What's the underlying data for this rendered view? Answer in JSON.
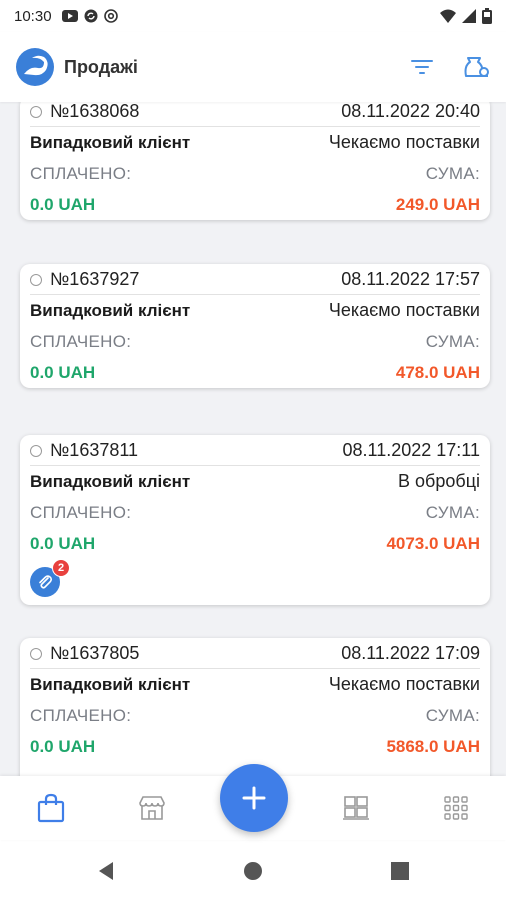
{
  "status_bar": {
    "time": "10:30"
  },
  "app_bar": {
    "title": "Продажі"
  },
  "orders": [
    {
      "number": "№1638068",
      "datetime": "08.11.2022 20:40",
      "client": "Випадковий клієнт",
      "status": "Чекаємо поставки",
      "paid_label": "СПЛАЧЕНО:",
      "sum_label": "СУМА:",
      "paid": "0.0 UAH",
      "sum": "249.0 UAH"
    },
    {
      "number": "№1637927",
      "datetime": "08.11.2022 17:57",
      "client": "Випадковий клієнт",
      "status": "Чекаємо поставки",
      "paid_label": "СПЛАЧЕНО:",
      "sum_label": "СУМА:",
      "paid": "0.0 UAH",
      "sum": "478.0 UAH"
    },
    {
      "number": "№1637811",
      "datetime": "08.11.2022 17:11",
      "client": "Випадковий клієнт",
      "status": "В обробці",
      "paid_label": "СПЛАЧЕНО:",
      "sum_label": "СУМА:",
      "paid": "0.0 UAH",
      "sum": "4073.0 UAH",
      "attachments": "2"
    },
    {
      "number": "№1637805",
      "datetime": "08.11.2022 17:09",
      "client": "Випадковий клієнт",
      "status": "Чекаємо поставки",
      "paid_label": "СПЛАЧЕНО:",
      "sum_label": "СУМА:",
      "paid": "0.0 UAH",
      "sum": "5868.0 UAH"
    }
  ],
  "colors": {
    "accent": "#3f7ee8",
    "paid": "#1fa66b",
    "sum": "#f2582a",
    "badge": "#e8413e"
  }
}
